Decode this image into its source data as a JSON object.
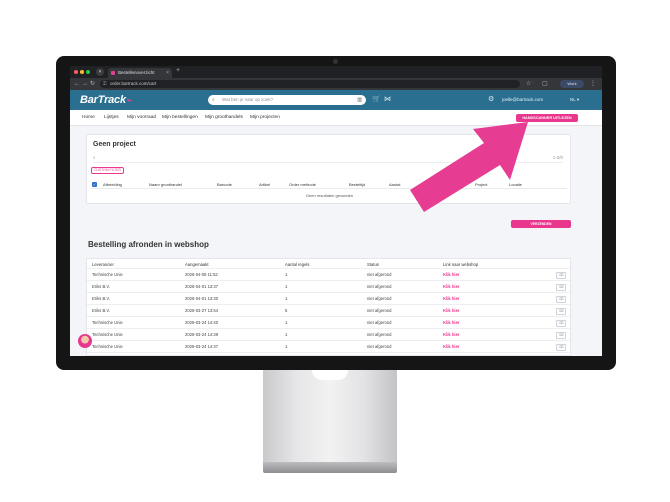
{
  "browser": {
    "tab_title": "Bestellenoverzicht",
    "url": "order.bartrack.com/cart",
    "profile_label": "Work"
  },
  "app": {
    "logo": "BarTrack",
    "search_placeholder": "Wat ben je naar op zoek?",
    "user_email": "joelle@bartrack.com",
    "language": "NL"
  },
  "nav": {
    "items": [
      "Home",
      "Lijstjes",
      "Mijn voorraad",
      "Mijn bestellingen",
      "Mijn groothandels",
      "Mijn projecten"
    ],
    "scan_button": "HANDSCANNER UITLEZEN"
  },
  "project": {
    "title": "Geen project",
    "count": "1-0/0",
    "custom_filter": "CUSTOM FILTER",
    "columns": [
      "Afbeelding",
      "Naam groothandel",
      "Barcode",
      "Artikel",
      "Order methode",
      "Besteltijd",
      "Aantal",
      "Prijs per stuk",
      "Project",
      "Locatie"
    ],
    "empty_text": "Geen resultaten gevonden",
    "send_button": "VERZENDEN"
  },
  "webshop": {
    "title": "Bestelling afronden in webshop",
    "columns": [
      "Leverancier",
      "Aangemaakt",
      "Aantal regels",
      "Status",
      "Link naar webshop"
    ],
    "rows": [
      {
        "supplier": "Technische Unie",
        "created": "2026-04-08 11:52",
        "lines": "1",
        "status": "niet afgerond",
        "link": "Klik hier"
      },
      {
        "supplier": "Eriks B.V.",
        "created": "2026-04-01 13:37",
        "lines": "1",
        "status": "niet afgerond",
        "link": "Klik hier"
      },
      {
        "supplier": "Eriks B.V.",
        "created": "2026-04-01 13:30",
        "lines": "1",
        "status": "niet afgerond",
        "link": "Klik hier"
      },
      {
        "supplier": "Eriks B.V.",
        "created": "2026-03-27 13:54",
        "lines": "5",
        "status": "niet afgerond",
        "link": "Klik hier"
      },
      {
        "supplier": "Technische Unie",
        "created": "2026-03-24 14:40",
        "lines": "1",
        "status": "niet afgerond",
        "link": "Klik hier"
      },
      {
        "supplier": "Technische Unie",
        "created": "2026-03-24 14:39",
        "lines": "1",
        "status": "niet afgerond",
        "link": "Klik hier"
      },
      {
        "supplier": "Technische Unie",
        "created": "2026-03-24 14:37",
        "lines": "1",
        "status": "niet afgerond",
        "link": "Klik hier"
      }
    ]
  },
  "colors": {
    "brand_blue": "#2a6f8f",
    "accent_pink": "#e8378d",
    "arrow_pink": "#e63d92"
  }
}
